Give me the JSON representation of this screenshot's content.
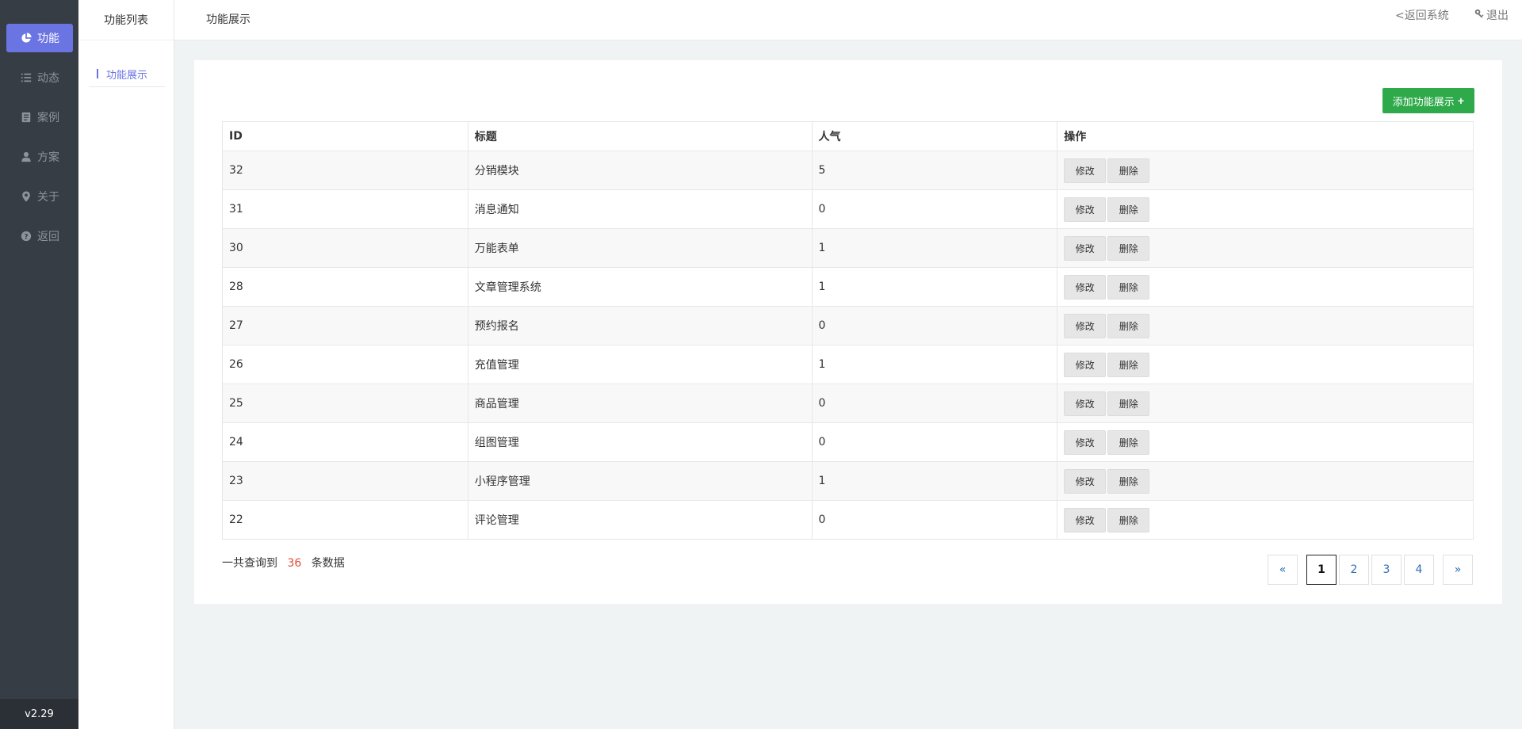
{
  "sidebar": {
    "items": [
      {
        "label": "功能",
        "icon": "pie-chart-icon"
      },
      {
        "label": "动态",
        "icon": "list-icon"
      },
      {
        "label": "案例",
        "icon": "document-icon"
      },
      {
        "label": "方案",
        "icon": "user-icon"
      },
      {
        "label": "关于",
        "icon": "map-pin-icon"
      },
      {
        "label": "返回",
        "icon": "question-circle-icon"
      }
    ],
    "version": "v2.29"
  },
  "subbar": {
    "title": "功能列表",
    "item": "功能展示"
  },
  "header": {
    "title": "功能展示",
    "back": "<返回系统",
    "logout": "退出"
  },
  "main": {
    "add_label": "添加功能展示",
    "columns": [
      "ID",
      "标题",
      "人气",
      "操作"
    ],
    "rows": [
      {
        "id": "32",
        "title": "分销模块",
        "pop": "5"
      },
      {
        "id": "31",
        "title": "消息通知",
        "pop": "0"
      },
      {
        "id": "30",
        "title": "万能表单",
        "pop": "1"
      },
      {
        "id": "28",
        "title": "文章管理系统",
        "pop": "1"
      },
      {
        "id": "27",
        "title": "预约报名",
        "pop": "0"
      },
      {
        "id": "26",
        "title": "充值管理",
        "pop": "1"
      },
      {
        "id": "25",
        "title": "商品管理",
        "pop": "0"
      },
      {
        "id": "24",
        "title": "组图管理",
        "pop": "0"
      },
      {
        "id": "23",
        "title": "小程序管理",
        "pop": "1"
      },
      {
        "id": "22",
        "title": "评论管理",
        "pop": "0"
      }
    ],
    "edit_label": "修改",
    "delete_label": "删除",
    "summary_prefix": "一共查询到",
    "summary_count": "36",
    "summary_suffix": "条数据",
    "pager": {
      "prev": "«",
      "pages": [
        "1",
        "2",
        "3",
        "4"
      ],
      "next": "»"
    }
  },
  "colors": {
    "accent": "#6b74e3",
    "add_button": "#2eaa4a",
    "count": "#e04a3a",
    "sidebar_bg": "#373d44"
  }
}
